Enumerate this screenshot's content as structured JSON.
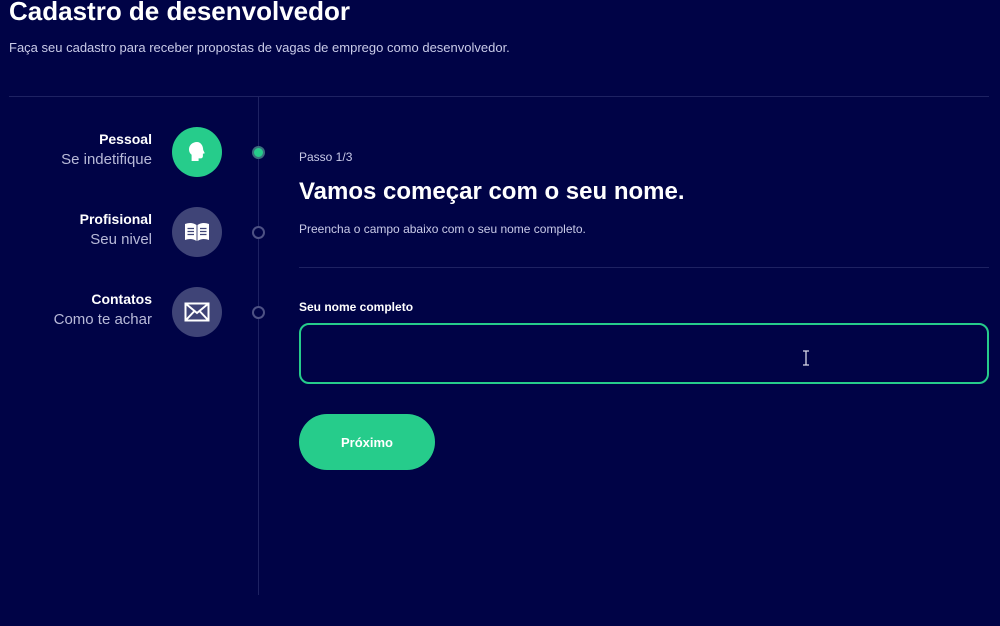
{
  "header": {
    "title": "Cadastro de desenvolvedor",
    "subtitle": "Faça seu cadastro para receber propostas de vagas de emprego como desenvolvedor."
  },
  "steps": [
    {
      "title": "Pessoal",
      "subtitle": "Se indetifique",
      "icon": "person-head-icon",
      "active": true
    },
    {
      "title": "Profisional",
      "subtitle": "Seu nivel",
      "icon": "book-icon",
      "active": false
    },
    {
      "title": "Contatos",
      "subtitle": "Como te achar",
      "icon": "envelope-icon",
      "active": false
    }
  ],
  "form": {
    "step_counter": "Passo 1/3",
    "heading": "Vamos começar com o seu nome.",
    "description": "Preencha o campo abaixo com o seu nome completo.",
    "field_label": "Seu nome completo",
    "field_value": "",
    "next_label": "Próximo"
  },
  "colors": {
    "background": "#000346",
    "accent": "#26cc8b",
    "inactive_icon": "#3f4477"
  }
}
